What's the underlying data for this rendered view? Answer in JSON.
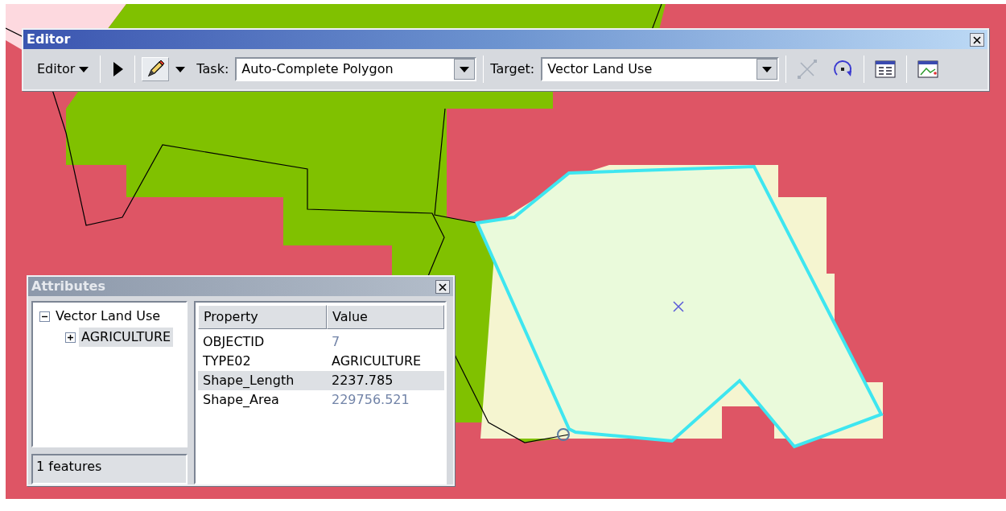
{
  "editor_toolbar": {
    "title": "Editor",
    "menu_label": "Editor",
    "sketch_tool": {
      "selected": true
    },
    "split_tool": {
      "disabled": true
    },
    "task_label": "Task:",
    "task_value": "Auto-Complete Polygon",
    "target_label": "Target:",
    "target_value": "Vector Land Use"
  },
  "attributes_window": {
    "title": "Attributes",
    "tree": [
      {
        "label": "Vector Land Use",
        "expanded": true,
        "selected": false,
        "children": [
          {
            "label": "AGRICULTURE",
            "expanded": false,
            "selected": true
          }
        ]
      }
    ],
    "status": "1 features",
    "columns": [
      "Property",
      "Value"
    ],
    "rows": [
      {
        "property": "OBJECTID",
        "value": "7",
        "read_only": true,
        "selected": false
      },
      {
        "property": "TYPE02",
        "value": "AGRICULTURE",
        "read_only": false,
        "selected": false
      },
      {
        "property": "Shape_Length",
        "value": "2237.785",
        "read_only": false,
        "selected": true
      },
      {
        "property": "Shape_Area",
        "value": "229756.521",
        "read_only": true,
        "selected": false
      }
    ]
  }
}
